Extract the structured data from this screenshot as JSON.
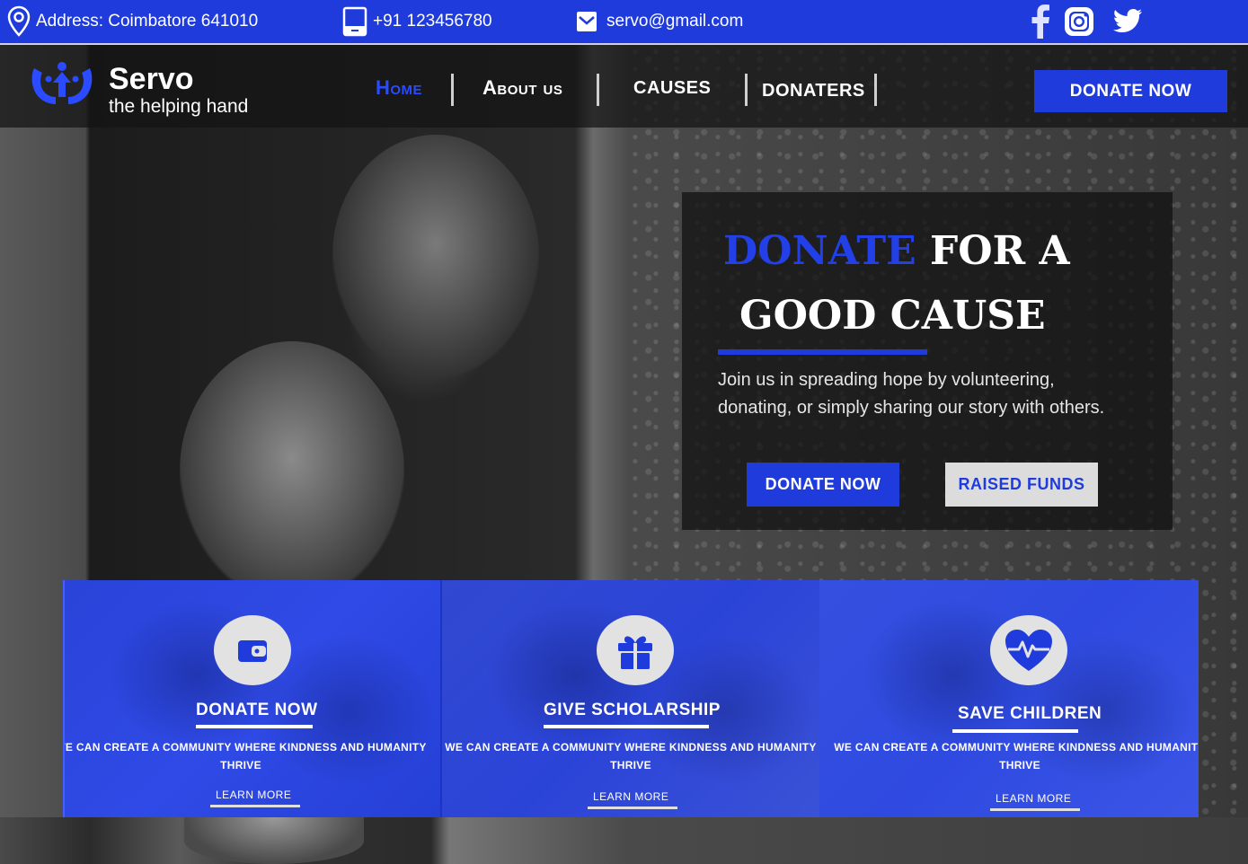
{
  "topbar": {
    "address": "Address: Coimbatore 641010",
    "phone": "+91 123456780",
    "email": "servo@gmail.com",
    "icons": [
      "location-pin-icon",
      "phone-icon",
      "mail-icon",
      "facebook-icon",
      "instagram-icon",
      "twitter-icon"
    ]
  },
  "brand": {
    "name": "Servo",
    "tagline": "the helping hand"
  },
  "nav": {
    "items": [
      {
        "label": "Home"
      },
      {
        "label": "About us"
      },
      {
        "label": "CAUSES"
      },
      {
        "label": "DONATERS"
      }
    ],
    "donate_label": "DONATE NOW"
  },
  "hero": {
    "title_accent": "DONATE",
    "title_rest": "FOR A",
    "title_line2": "GOOD CAUSE",
    "text": "Join us in spreading hope by volunteering, donating, or simply sharing our story with others.",
    "donate_label": "DONATE NOW",
    "funds_label": "RAISED FUNDS"
  },
  "cards": [
    {
      "title": "DONATE NOW",
      "desc": "WE CAN CREATE A COMMUNITY WHERE KINDNESS AND HUMANITY THRIVE",
      "link": "LEARN MORE",
      "icon": "wallet-icon"
    },
    {
      "title": "GIVE SCHOLARSHIP",
      "desc": "WE CAN CREATE A COMMUNITY WHERE KINDNESS AND HUMANITY THRIVE",
      "link": "LEARN MORE",
      "icon": "gift-icon"
    },
    {
      "title": "SAVE CHILDREN",
      "desc": "WE CAN CREATE A COMMUNITY WHERE KINDNESS AND HUMANITY THRIVE",
      "link": "LEARN MORE",
      "icon": "heartbeat-icon"
    }
  ],
  "colors": {
    "accent": "#1f3bdc",
    "accent_light": "#2a4bff",
    "dark_overlay": "#141414",
    "light_button": "#dcdcdc"
  }
}
